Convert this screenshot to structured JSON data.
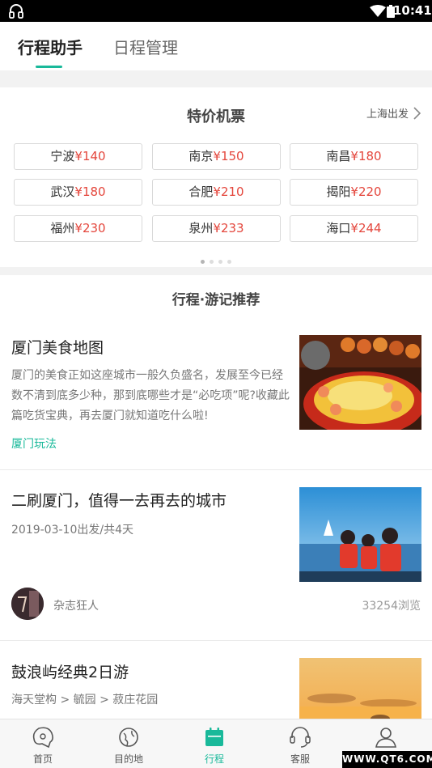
{
  "status_bar": {
    "time": "10:41"
  },
  "header": {
    "tabs": [
      {
        "label": "行程助手",
        "active": true
      },
      {
        "label": "日程管理",
        "active": false
      }
    ]
  },
  "flights": {
    "title": "特价机票",
    "departure": "上海出发",
    "fares": [
      {
        "city": "宁波",
        "price": "¥140"
      },
      {
        "city": "南京",
        "price": "¥150"
      },
      {
        "city": "南昌",
        "price": "¥180"
      },
      {
        "city": "武汉",
        "price": "¥180"
      },
      {
        "city": "合肥",
        "price": "¥210"
      },
      {
        "city": "揭阳",
        "price": "¥220"
      },
      {
        "city": "福州",
        "price": "¥230"
      },
      {
        "city": "泉州",
        "price": "¥233"
      },
      {
        "city": "海口",
        "price": "¥244"
      }
    ],
    "page_count": 4,
    "current_page": 1
  },
  "recommend": {
    "title": "行程·游记推荐",
    "cards": [
      {
        "title": "厦门美食地图",
        "description": "厦门的美食正如这座城市一般久负盛名，发展至今已经数不清到底多少种，那到底哪些才是“必吃项”呢?收藏此篇吃货宝典，再去厦门就知道吃什么啦!",
        "tag": "厦门玩法"
      },
      {
        "title": "二刷厦门，值得一去再去的城市",
        "meta": "2019-03-10出发/共4天",
        "author": "杂志狂人",
        "views": "33254浏览"
      },
      {
        "title": "鼓浪屿经典2日游",
        "route": "海天堂构 > 毓园 > 菽庄花园"
      }
    ]
  },
  "bottom_nav": {
    "items": [
      {
        "label": "首页",
        "icon": "home-icon"
      },
      {
        "label": "目的地",
        "icon": "destination-icon"
      },
      {
        "label": "行程",
        "icon": "itinerary-icon",
        "active": true
      },
      {
        "label": "客服",
        "icon": "customer-service-icon"
      },
      {
        "label": "我的",
        "icon": "profile-icon"
      }
    ]
  },
  "watermark": "WWW.QT6.COM",
  "colors": {
    "accent": "#19b99a",
    "price": "#e4463c"
  }
}
